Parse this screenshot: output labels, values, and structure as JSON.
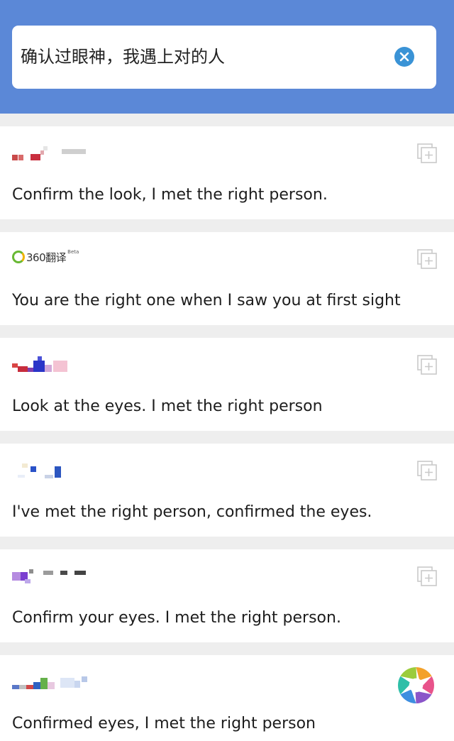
{
  "search": {
    "query": "确认过眼神，我遇上对的人"
  },
  "results": [
    {
      "provider_name": "",
      "translation": "Confirm the look, I met the right person."
    },
    {
      "provider_name": "360翻译",
      "provider_badge": "Beta",
      "translation": "You are the right one when I saw you at first sight"
    },
    {
      "provider_name": "",
      "translation": "Look at the eyes. I met the right person"
    },
    {
      "provider_name": "",
      "translation": "I've met the right person, confirmed the eyes."
    },
    {
      "provider_name": "",
      "translation": "Confirm your eyes. I met the right person."
    },
    {
      "provider_name": "",
      "translation": "Confirmed eyes, I met the right person"
    }
  ],
  "colors": {
    "header": "#5b88d7",
    "clear_button": "#3a93d6",
    "separator": "#eeeeee",
    "text": "#1d1d1d"
  },
  "icons": {
    "clear": "clear-icon",
    "copy": "add-square-icon",
    "logo_360": "360-ring-logo",
    "aperture": "aperture-logo"
  }
}
